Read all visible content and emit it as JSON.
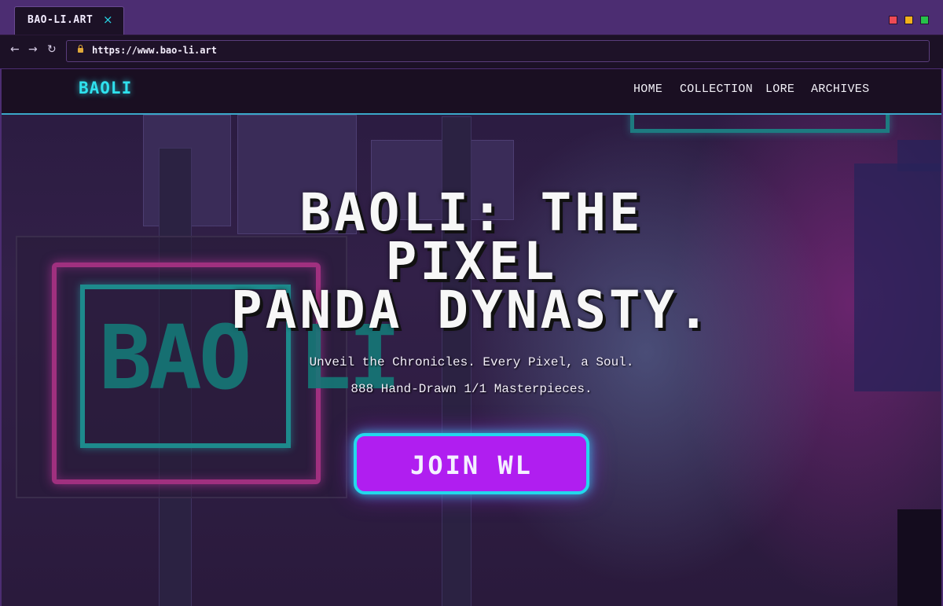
{
  "browser": {
    "tab_label": "BAO-LI.ART",
    "tab_close": "×",
    "url": "https://www.bao-li.art",
    "nav": {
      "back": "←",
      "forward": "→",
      "reload": "↻"
    }
  },
  "site": {
    "logo": "BAOLI",
    "nav": [
      "HOME",
      "COLLECTION",
      "LORE",
      "ARCHIVES"
    ]
  },
  "hero": {
    "title_lines": [
      "BAOLI: THE",
      "PIXEL",
      "PANDA DYNASTY."
    ],
    "subtitle_1": "Unveil the Chronicles. Every Pixel, a Soul.",
    "subtitle_2": "888 Hand-Drawn 1/1 Masterpieces.",
    "cta": "JOIN WL",
    "sign_text": "BAO LI"
  },
  "colors": {
    "accent_cyan": "#2fe2ef",
    "cta_purple": "#b01ef0",
    "window_red": "#ee4a55",
    "window_yellow": "#f2b11a",
    "window_green": "#27c24a"
  }
}
